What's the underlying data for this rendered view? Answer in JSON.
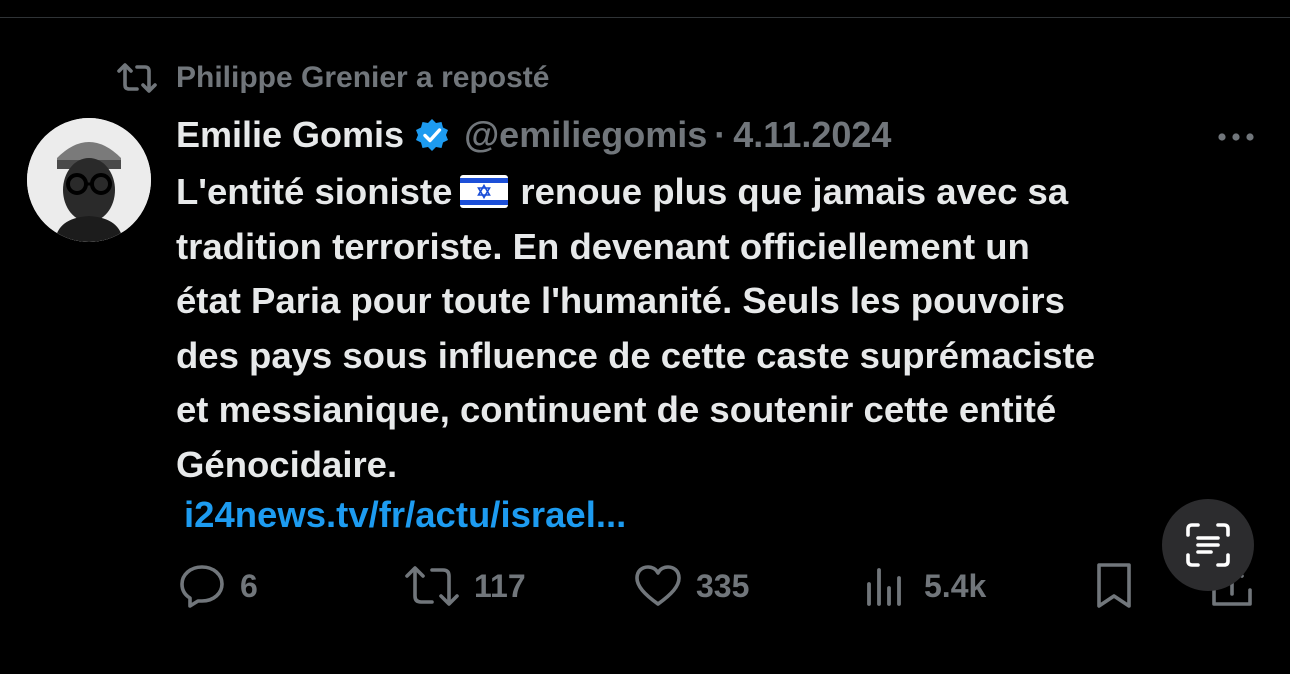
{
  "repost_banner": {
    "text": "Philippe Grenier a reposté",
    "icon": "repost-icon"
  },
  "author": {
    "display_name": "Emilie Gomis",
    "handle": "@emiliegomis",
    "verified": true,
    "verified_icon": "verified-badge-icon",
    "avatar_icon": "avatar"
  },
  "meta": {
    "separator": "·",
    "date": "4.11.2024"
  },
  "tweet": {
    "line1_before_flag": "L'entité sioniste",
    "flag_icon": "israel-flag-emoji",
    "line1_after_flag": "renoue plus que jamais avec sa",
    "line2": "tradition terroriste. En devenant officiellement un",
    "line3": "état Paria pour toute l'humanité. Seuls les pouvoirs",
    "line4": "des pays sous influence de cette caste suprémaciste",
    "line5": "et messianique, continuent de soutenir cette entité",
    "line6": "Génocidaire.",
    "link_text": "i24news.tv/fr/actu/israel..."
  },
  "actions": {
    "replies": "6",
    "reposts": "117",
    "likes": "335",
    "views": "5.4k"
  },
  "colors": {
    "background": "#000000",
    "text": "#e7e9ea",
    "muted": "#71767b",
    "link": "#1d9bf0",
    "verified": "#1d9bf0",
    "scan_button": "#2c2c2e"
  }
}
